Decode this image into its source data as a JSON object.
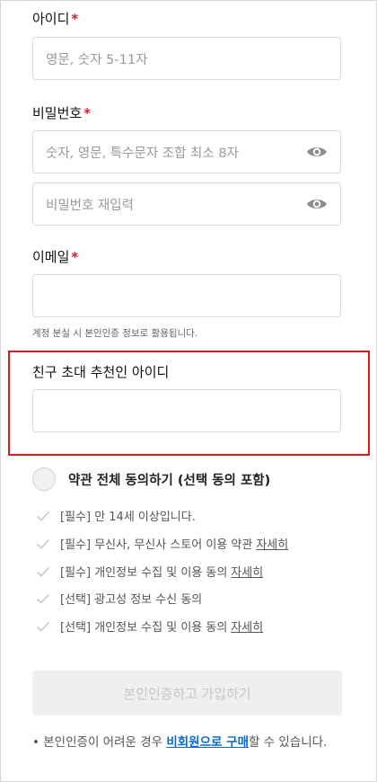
{
  "form": {
    "id_label": "아이디",
    "id_placeholder": "영문, 숫자 5-11자",
    "pw_label": "비밀번호",
    "pw_placeholder": "숫자, 영문, 특수문자 조합 최소 8자",
    "pw_confirm_placeholder": "비밀번호 재입력",
    "email_label": "이메일",
    "email_hint": "계정 분실 시 본인인증 정보로 활용됩니다.",
    "referral_label": "친구 초대 추천인 아이디",
    "required_mark": "*"
  },
  "terms": {
    "all_label": "약관 전체 동의하기 (선택 동의 포함)",
    "items": [
      {
        "text": "[필수] 만 14세 이상입니다.",
        "link": ""
      },
      {
        "text": "[필수] 무신사, 무신사 스토어 이용 약관",
        "link": "자세히"
      },
      {
        "text": "[필수] 개인정보 수집 및 이용 동의",
        "link": "자세히"
      },
      {
        "text": "[선택] 광고성 정보 수신 동의",
        "link": ""
      },
      {
        "text": "[선택] 개인정보 수집 및 이용 동의",
        "link": "자세히"
      }
    ]
  },
  "submit_label": "본인인증하고 가입하기",
  "note": {
    "bullet": "•",
    "prefix": "본인인증이 어려운 경우 ",
    "link": "비회원으로 구매",
    "suffix": "할 수 있습니다."
  },
  "colors": {
    "required": "#e21a2a",
    "highlight": "#e8141c",
    "link": "#0a6ad4"
  },
  "icons": {
    "password_toggle": "eye-icon",
    "term_check": "check-icon"
  }
}
